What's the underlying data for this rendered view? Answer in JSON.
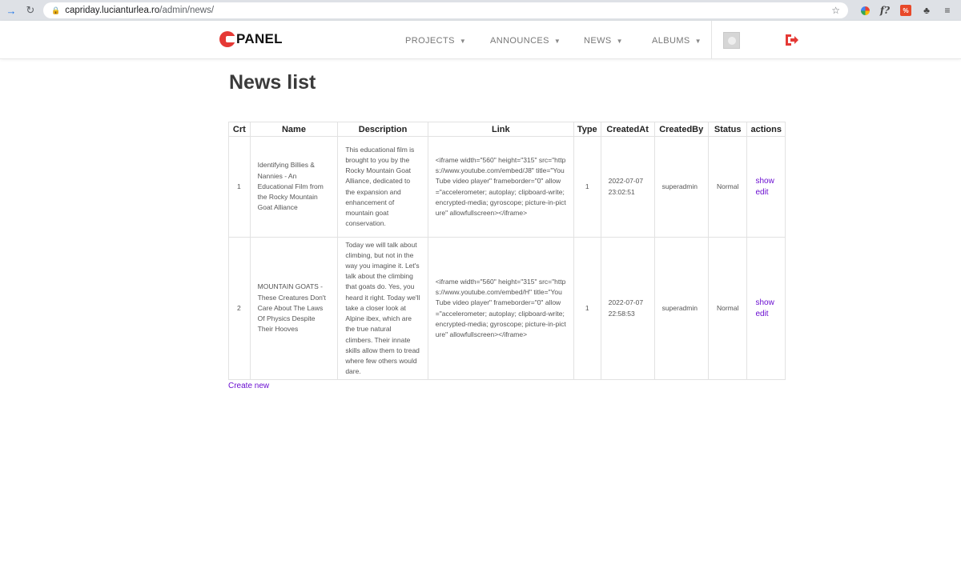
{
  "browser": {
    "url_host": "capriday.lucianturlea.ro",
    "url_path": "/admin/news/",
    "ext_fx": "f?",
    "ext_bm": "%"
  },
  "header": {
    "logo_text": "PANEL",
    "menu": [
      {
        "label": "PROJECTS"
      },
      {
        "label": "ANNOUNCES"
      },
      {
        "label": "NEWS"
      },
      {
        "label": "ALBUMS"
      }
    ],
    "accent_color": "#e53935"
  },
  "page": {
    "title": "News list",
    "create_link": "Create new"
  },
  "table": {
    "columns": [
      "Crt",
      "Name",
      "Description",
      "Link",
      "Type",
      "CreatedAt",
      "CreatedBy",
      "Status",
      "actions"
    ],
    "rows": [
      {
        "crt": "1",
        "name": "Identifying Billies & Nannies - An Educational Film from the Rocky Mountain Goat Alliance",
        "description": "This educational film is brought to you by the Rocky Mountain Goat Alliance, dedicated to the expansion and enhancement of mountain goat conservation.",
        "link": "<iframe width=\"560\" height=\"315\" src=\"https://www.youtube.com/embed/J8\" title=\"YouTube video player\" frameborder=\"0\" allow=\"accelerometer; autoplay; clipboard-write; encrypted-media; gyroscope; picture-in-picture\" allowfullscreen></iframe>",
        "type": "1",
        "created_at": "2022-07-07 23:02:51",
        "created_by": "superadmin",
        "status": "Normal",
        "action_show": "show",
        "action_edit": "edit"
      },
      {
        "crt": "2",
        "name": "MOUNTAIN GOATS - These Creatures Don't Care About The Laws Of Physics Despite Their Hooves",
        "description": "Today we will talk about climbing, but not in the way you imagine it. Let's talk about the climbing that goats do. Yes, you heard it right. Today we'll take a closer look at Alpine ibex, which are the true natural climbers. Their innate skills allow them to tread where few others would dare.",
        "link": "<iframe width=\"560\" height=\"315\" src=\"https://www.youtube.com/embed/H\" title=\"YouTube video player\" frameborder=\"0\" allow=\"accelerometer; autoplay; clipboard-write; encrypted-media; gyroscope; picture-in-picture\" allowfullscreen></iframe>",
        "type": "1",
        "created_at": "2022-07-07 22:58:53",
        "created_by": "superadmin",
        "status": "Normal",
        "action_show": "show",
        "action_edit": "edit"
      }
    ]
  }
}
